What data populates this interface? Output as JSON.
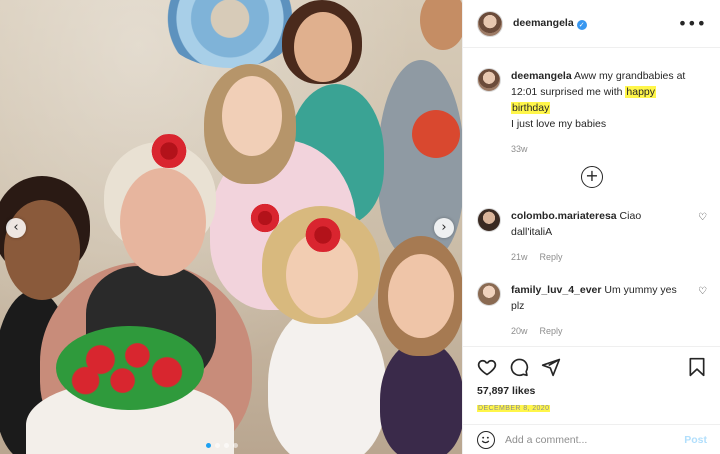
{
  "photo": {
    "prev_icon": "chevron-left-icon",
    "next_icon": "chevron-right-icon",
    "prev_glyph": "‹",
    "next_glyph": "›",
    "slide_count": 4,
    "active_slide": 1
  },
  "header": {
    "username": "deemangela",
    "verified_glyph": "✓",
    "more_glyph": "•••",
    "more_icon": "more-options-icon"
  },
  "caption": {
    "username": "deemangela",
    "text_before": " Aww my grandbabies at 12:01 surprised me with ",
    "highlight_1": "happy",
    "highlight_2": "birthday",
    "line2": "I just love my babies",
    "time": "33w"
  },
  "load_more": {
    "glyph": "+",
    "icon": "load-more-comments-icon"
  },
  "comments": [
    {
      "username": "colombo.mariateresa",
      "text": " Ciao dall'italiA",
      "time": "21w",
      "reply": "Reply",
      "heart_glyph": "♡"
    },
    {
      "username": "family_luv_4_ever",
      "text": " Um yummy yes plz",
      "time": "20w",
      "reply": "Reply",
      "heart_glyph": "♡"
    }
  ],
  "actions": {
    "like_icon": "heart-icon",
    "comment_icon": "comment-icon",
    "share_icon": "share-icon",
    "save_icon": "bookmark-icon",
    "likes": "57,897 likes",
    "date": "December 8, 2020"
  },
  "add_comment": {
    "emoji_icon": "emoji-icon",
    "placeholder": "Add a comment...",
    "post_label": "Post"
  },
  "colors": {
    "accent": "#3897f0",
    "highlight": "#fff64a",
    "post_disabled": "#b2dffc",
    "muted": "#8e8e8e"
  }
}
